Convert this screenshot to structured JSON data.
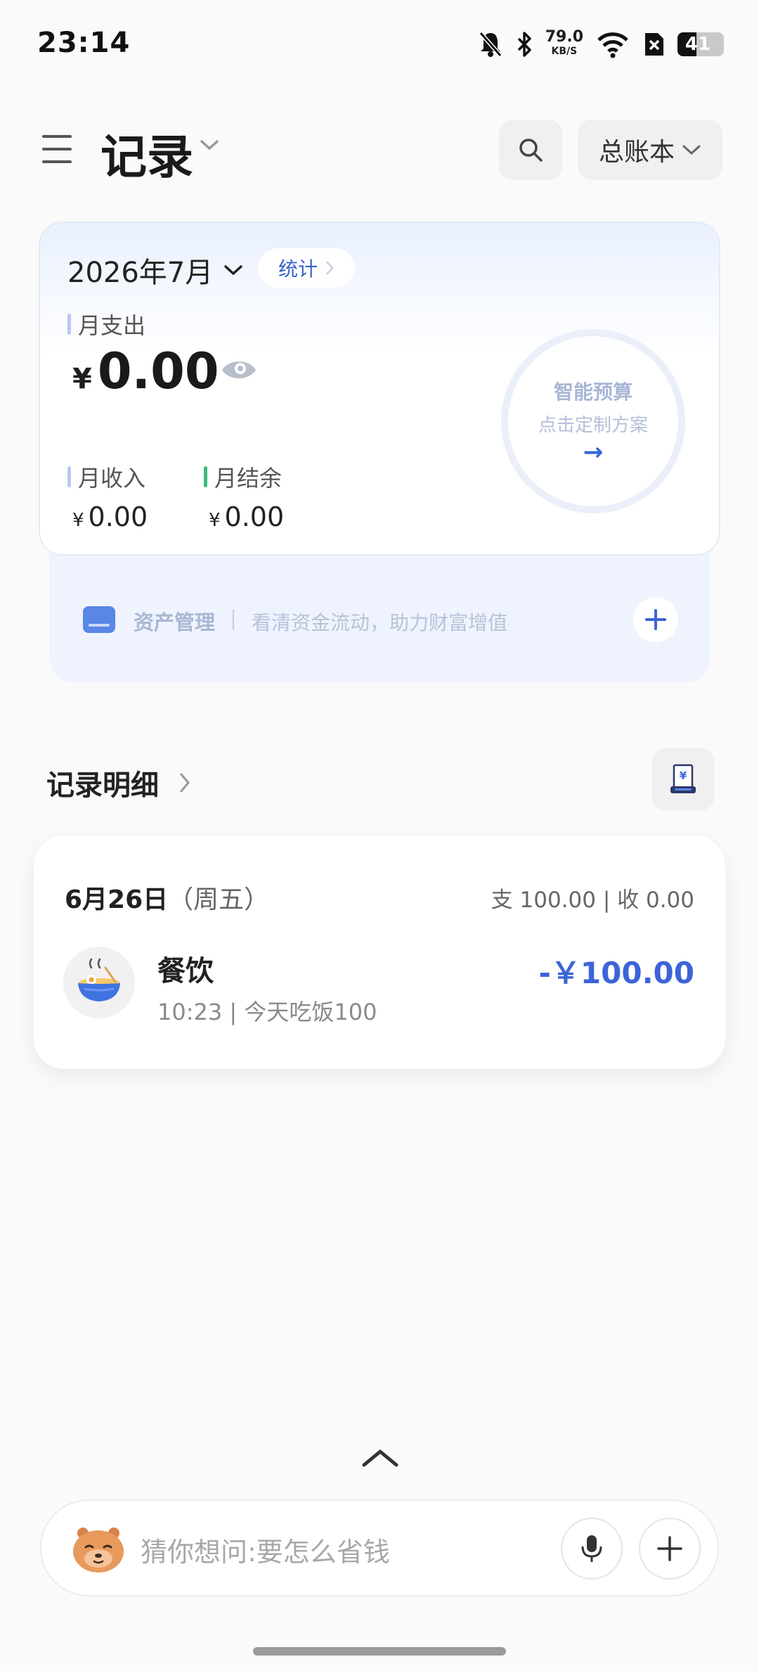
{
  "status_bar": {
    "time": "23:14",
    "net_speed_value": "79.0",
    "net_speed_unit": "KB/S",
    "battery": "41",
    "battery_level": 0.41,
    "icons": [
      "bell-muted-icon",
      "bluetooth-icon",
      "wifi-icon",
      "sim-off-icon",
      "battery-icon"
    ]
  },
  "header": {
    "title": "记录",
    "ledger_label": "总账本",
    "icons": [
      "menu-icon",
      "chevron-down-icon",
      "search-icon"
    ]
  },
  "summary": {
    "month_label": "2026年7月",
    "stats_label": "统计",
    "expense_label": "月支出",
    "currency": "¥",
    "expense_value": "0.00",
    "income_label": "月收入",
    "income_value": "0.00",
    "balance_label": "月结余",
    "balance_value": "0.00",
    "budget_title": "智能预算",
    "budget_subtitle": "点击定制方案",
    "budget_arrow": "→",
    "colors": {
      "income_bar": "#b9c8f0",
      "balance_bar": "#3cba7a",
      "accent": "#3c64d8"
    }
  },
  "asset": {
    "title": "资产管理",
    "separator": "|",
    "description": "看清资金流动，助力财富增值"
  },
  "records": {
    "section_title": "记录明细",
    "days": [
      {
        "date": "6月26日",
        "weekday": "（周五）",
        "summary": "支 100.00 | 收 0.00",
        "items": [
          {
            "category": "餐饮",
            "meta": "10:23 | 今天吃饭100",
            "amount": "-￥100.00",
            "icon": "food-bowl-icon"
          }
        ]
      }
    ]
  },
  "bottom": {
    "placeholder": "猜你想问:要怎么省钱",
    "icons": [
      "chevron-up-icon",
      "mascot-icon",
      "mic-icon",
      "plus-icon"
    ]
  }
}
